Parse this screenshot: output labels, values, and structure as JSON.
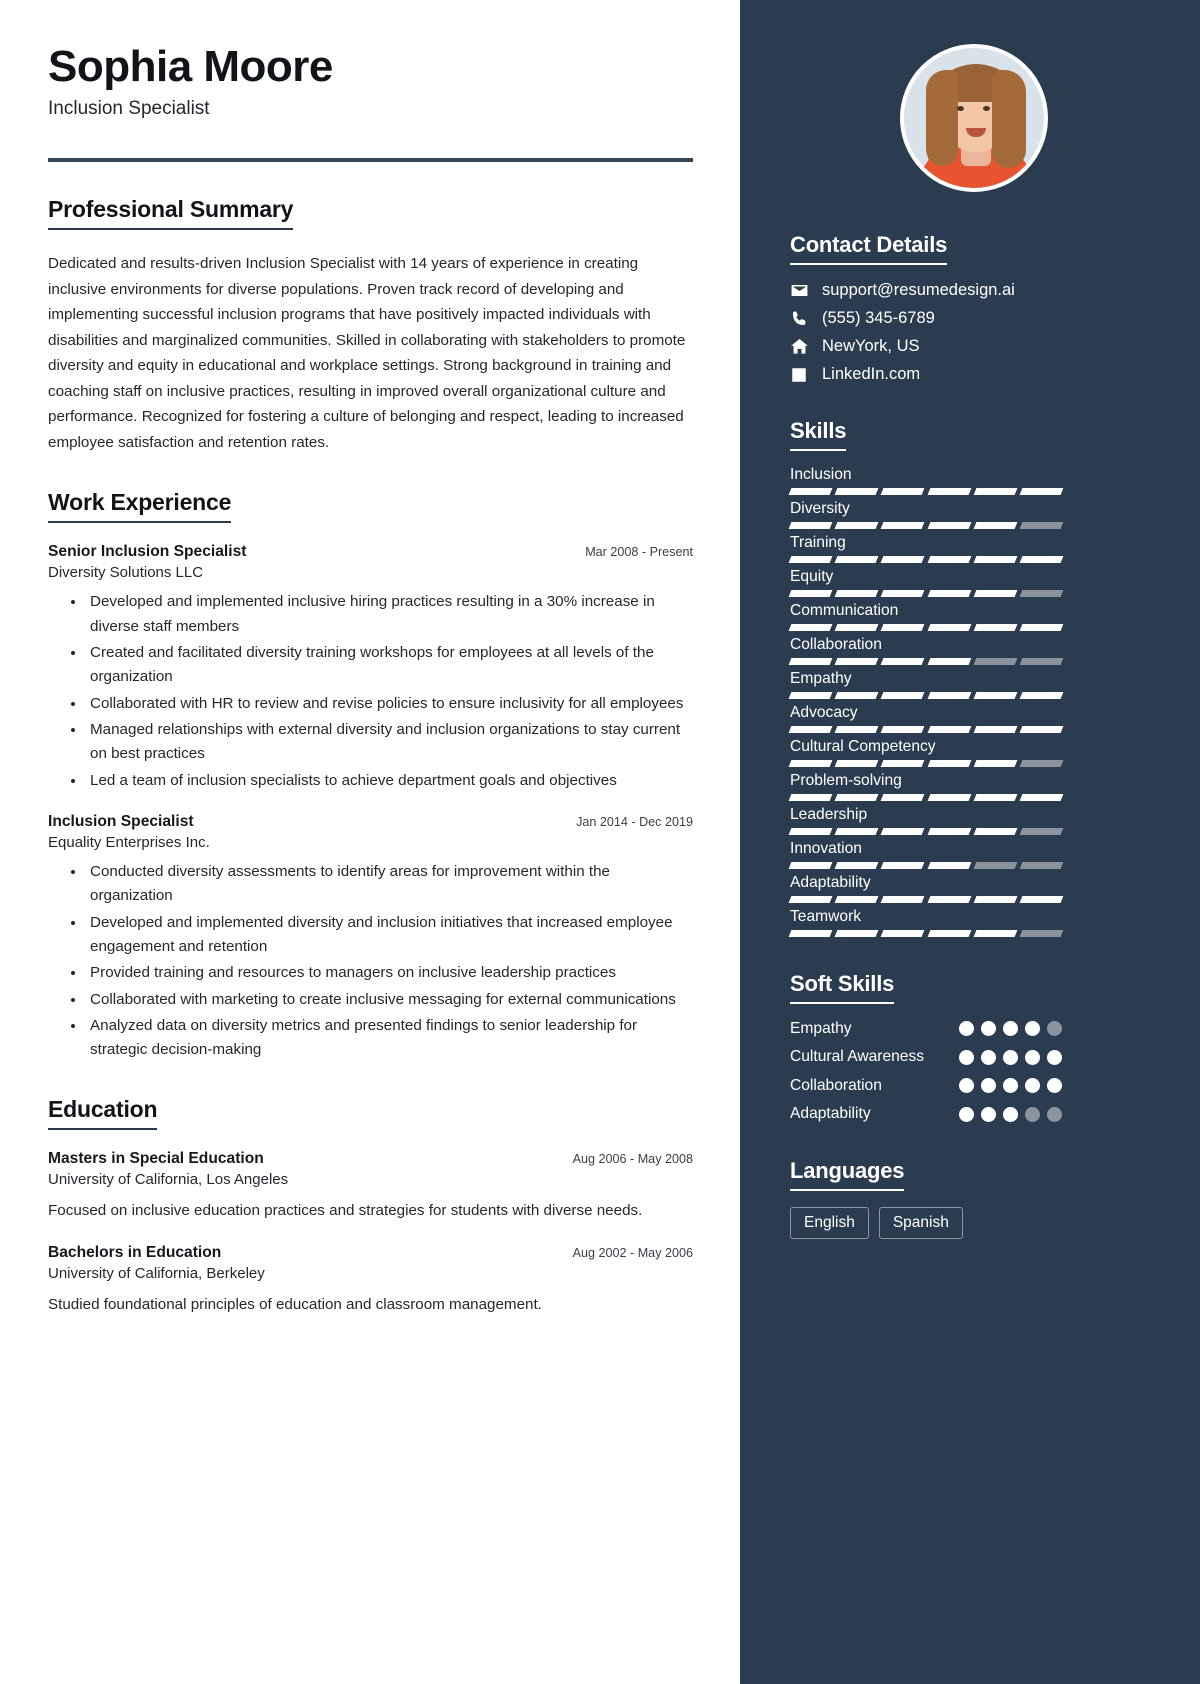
{
  "header": {
    "name": "Sophia Moore",
    "title": "Inclusion Specialist"
  },
  "sections": {
    "summary_title": "Professional Summary",
    "experience_title": "Work Experience",
    "education_title": "Education"
  },
  "summary": "Dedicated and results-driven Inclusion Specialist with 14 years of experience in creating inclusive environments for diverse populations. Proven track record of developing and implementing successful inclusion programs that have positively impacted individuals with disabilities and marginalized communities. Skilled in collaborating with stakeholders to promote diversity and equity in educational and workplace settings. Strong background in training and coaching staff on inclusive practices, resulting in improved overall organizational culture and performance. Recognized for fostering a culture of belonging and respect, leading to increased employee satisfaction and retention rates.",
  "experience": [
    {
      "role": "Senior Inclusion Specialist",
      "date": "Mar 2008 - Present",
      "org": "Diversity Solutions LLC",
      "bullets": [
        "Developed and implemented inclusive hiring practices resulting in a 30% increase in diverse staff members",
        "Created and facilitated diversity training workshops for employees at all levels of the organization",
        "Collaborated with HR to review and revise policies to ensure inclusivity for all employees",
        "Managed relationships with external diversity and inclusion organizations to stay current on best practices",
        "Led a team of inclusion specialists to achieve department goals and objectives"
      ]
    },
    {
      "role": "Inclusion Specialist",
      "date": "Jan 2014 - Dec 2019",
      "org": "Equality Enterprises Inc.",
      "bullets": [
        "Conducted diversity assessments to identify areas for improvement within the organization",
        "Developed and implemented diversity and inclusion initiatives that increased employee engagement and retention",
        "Provided training and resources to managers on inclusive leadership practices",
        "Collaborated with marketing to create inclusive messaging for external communications",
        "Analyzed data on diversity metrics and presented findings to senior leadership for strategic decision-making"
      ]
    }
  ],
  "education": [
    {
      "degree": "Masters in Special Education",
      "date": "Aug 2006 - May 2008",
      "school": "University of California, Los Angeles",
      "note": "Focused on inclusive education practices and strategies for students with diverse needs."
    },
    {
      "degree": "Bachelors in Education",
      "date": "Aug 2002 - May 2006",
      "school": "University of California, Berkeley",
      "note": "Studied foundational principles of education and classroom management."
    }
  ],
  "sidebar": {
    "contact_title": "Contact Details",
    "contact": [
      {
        "icon": "envelope-icon",
        "value": "support@resumedesign.ai"
      },
      {
        "icon": "phone-icon",
        "value": "(555) 345-6789"
      },
      {
        "icon": "home-icon",
        "value": "NewYork, US"
      },
      {
        "icon": "linkedin-icon",
        "value": "LinkedIn.com"
      }
    ],
    "skills_title": "Skills",
    "skills": [
      {
        "name": "Inclusion",
        "filled": 6,
        "total": 6
      },
      {
        "name": "Diversity",
        "filled": 5,
        "total": 6
      },
      {
        "name": "Training",
        "filled": 6,
        "total": 6
      },
      {
        "name": "Equity",
        "filled": 5,
        "total": 6
      },
      {
        "name": "Communication",
        "filled": 6,
        "total": 6
      },
      {
        "name": "Collaboration",
        "filled": 4,
        "total": 6
      },
      {
        "name": "Empathy",
        "filled": 6,
        "total": 6
      },
      {
        "name": "Advocacy",
        "filled": 6,
        "total": 6
      },
      {
        "name": "Cultural Competency",
        "filled": 5,
        "total": 6
      },
      {
        "name": "Problem-solving",
        "filled": 6,
        "total": 6
      },
      {
        "name": "Leadership",
        "filled": 5,
        "total": 6
      },
      {
        "name": "Innovation",
        "filled": 4,
        "total": 6
      },
      {
        "name": "Adaptability",
        "filled": 6,
        "total": 6
      },
      {
        "name": "Teamwork",
        "filled": 5,
        "total": 6
      }
    ],
    "soft_skills_title": "Soft Skills",
    "soft_skills": [
      {
        "name": "Empathy",
        "filled": 4,
        "total": 5
      },
      {
        "name": "Cultural Awareness",
        "filled": 5,
        "total": 5
      },
      {
        "name": "Collaboration",
        "filled": 5,
        "total": 5
      },
      {
        "name": "Adaptability",
        "filled": 3,
        "total": 5
      }
    ],
    "languages_title": "Languages",
    "languages": [
      "English",
      "Spanish"
    ]
  },
  "colors": {
    "sidebar_bg": "#2b3c50",
    "rule": "#32465c",
    "muted": "#8b949d"
  }
}
